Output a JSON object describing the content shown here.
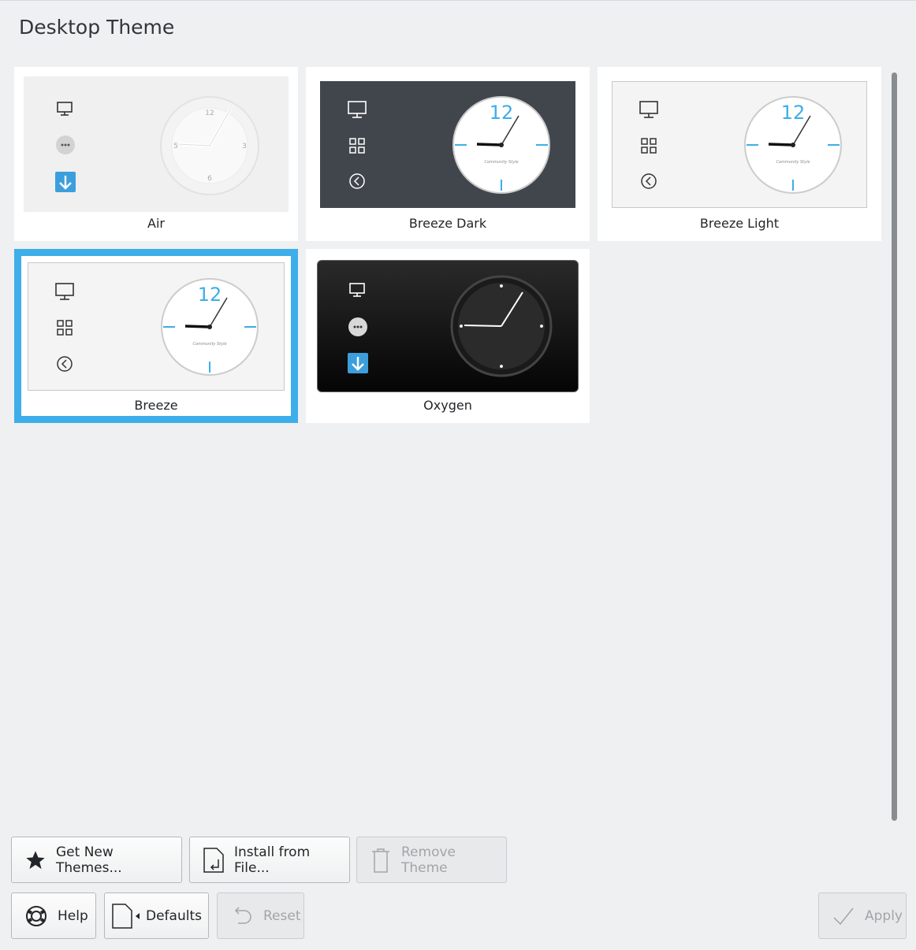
{
  "page": {
    "title": "Desktop Theme"
  },
  "themes": [
    {
      "name": "Air",
      "selected": false
    },
    {
      "name": "Breeze Dark",
      "selected": false
    },
    {
      "name": "Breeze Light",
      "selected": false
    },
    {
      "name": "Breeze",
      "selected": true
    },
    {
      "name": "Oxygen",
      "selected": false
    }
  ],
  "preview_clock": {
    "twelve": "12",
    "three": "3",
    "six": "6",
    "nine": "5",
    "brand": "Community Style"
  },
  "buttons": {
    "get_new": "Get New Themes...",
    "install": "Install from File...",
    "remove": "Remove Theme",
    "help": "Help",
    "defaults": "Defaults",
    "reset": "Reset",
    "apply": "Apply"
  },
  "colors": {
    "accent": "#3daee9",
    "background": "#eff0f1"
  }
}
